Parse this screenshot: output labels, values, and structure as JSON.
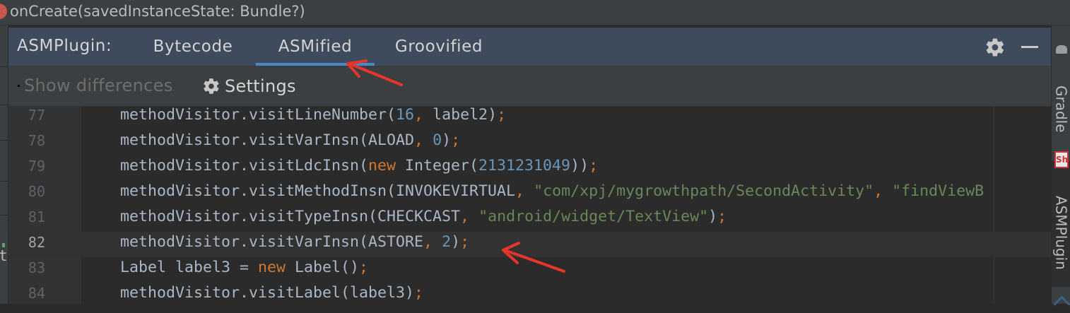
{
  "breadcrumb": {
    "text": "onCreate(savedInstanceState: Bundle?)"
  },
  "left_strip": {
    "glyph": "t"
  },
  "tool_window": {
    "title": "ASMPlugin:",
    "tabs": [
      {
        "label": "Bytecode",
        "selected": false
      },
      {
        "label": "ASMified",
        "selected": true
      },
      {
        "label": "Groovified",
        "selected": false
      }
    ]
  },
  "toolbar": {
    "show_differences_label": "Show differences",
    "settings_label": "Settings"
  },
  "right_stripe": {
    "gradle_label": "Gradle",
    "asm_label": "ASMPlugin",
    "plugin_icon_text": "Sh"
  },
  "editor": {
    "current_line": 82,
    "lines": [
      {
        "number": "77",
        "text": "methodVisitor.visitLineNumber(16, label2);"
      },
      {
        "number": "78",
        "text": "methodVisitor.visitVarInsn(ALOAD, 0);"
      },
      {
        "number": "79",
        "text": "methodVisitor.visitLdcInsn(new Integer(2131231049));"
      },
      {
        "number": "80",
        "text": "methodVisitor.visitMethodInsn(INVOKEVIRTUAL, \"com/xpj/mygrowthpath/SecondActivity\", \"findViewB"
      },
      {
        "number": "81",
        "text": "methodVisitor.visitTypeInsn(CHECKCAST, \"android/widget/TextView\");"
      },
      {
        "number": "82",
        "text": "methodVisitor.visitVarInsn(ASTORE, 2);"
      },
      {
        "number": "83",
        "text": "Label label3 = new Label();"
      },
      {
        "number": "84",
        "text": "methodVisitor.visitLabel(label3);"
      }
    ]
  },
  "colors": {
    "accent_underline": "#4a88c7",
    "annotation_arrow": "#e8352b",
    "keyword": "#cc7832",
    "number": "#6897bb",
    "string": "#6a8759"
  }
}
